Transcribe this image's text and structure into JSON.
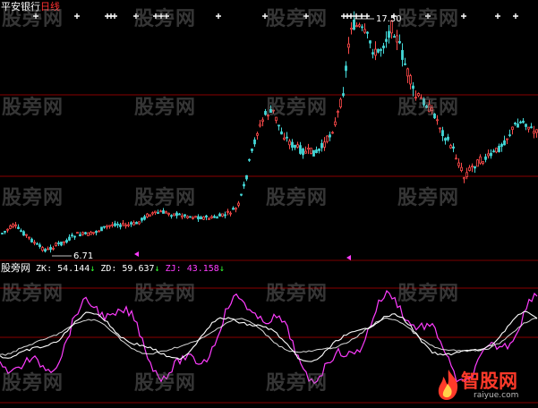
{
  "header": {
    "symbol": "平安银行",
    "period": "日线"
  },
  "price_panel": {
    "high_label": "17.50",
    "low_label": "6.71"
  },
  "indicator": {
    "name": "股旁网",
    "zk_label": "ZK:",
    "zk_value": "54.144",
    "zk_arrow": "↓",
    "zd_label": "ZD:",
    "zd_value": "59.637",
    "zd_arrow": "↓",
    "zj_label": "ZJ:",
    "zj_value": "43.158",
    "zj_arrow": "↓"
  },
  "watermark": {
    "text": "股旁网"
  },
  "brand": {
    "name": "智股网",
    "url": "raiyue.com"
  },
  "colors": {
    "up_candle": "#ff4a4a",
    "down_candle": "#44d8d8",
    "zk_line": "#ffffff",
    "zd_line": "#ffffff",
    "zj_line": "#ff3cff",
    "grid": "#8a0000",
    "marker": "#ffffff",
    "divider_arrow": "#ff3cff"
  },
  "icons": {
    "top_marker": "white-plus-cross",
    "section_marker": "magenta-triangle-left",
    "brand_logo": "red-flame-icon"
  }
}
